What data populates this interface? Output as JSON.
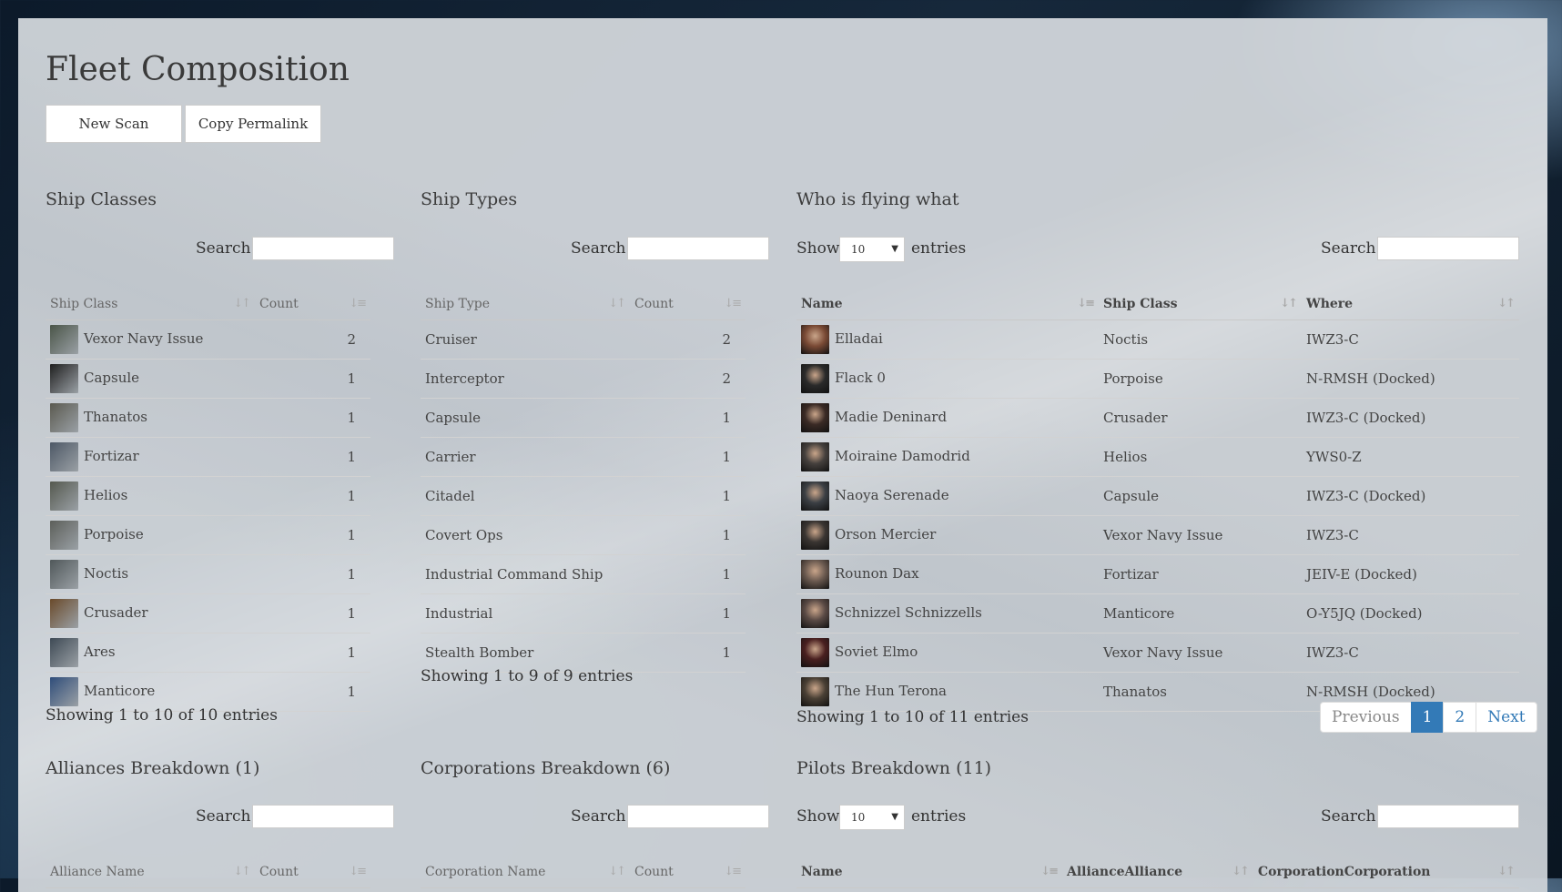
{
  "page_title": "Fleet Composition",
  "buttons": {
    "new_scan": "New Scan",
    "copy_permalink": "Copy Permalink"
  },
  "search_label": "Search:",
  "show_label": "Show",
  "entries_label": "entries",
  "ship_classes": {
    "title": "Ship Classes",
    "columns": [
      "Ship Class",
      "Count"
    ],
    "rows": [
      {
        "name": "Vexor Navy Issue",
        "count": "2",
        "color": "#4a5548"
      },
      {
        "name": "Capsule",
        "count": "1",
        "color": "#1f1f1f"
      },
      {
        "name": "Thanatos",
        "count": "1",
        "color": "#5b5a50"
      },
      {
        "name": "Fortizar",
        "count": "1",
        "color": "#4d5866"
      },
      {
        "name": "Helios",
        "count": "1",
        "color": "#55594f"
      },
      {
        "name": "Porpoise",
        "count": "1",
        "color": "#5c5f5a"
      },
      {
        "name": "Noctis",
        "count": "1",
        "color": "#50585a"
      },
      {
        "name": "Crusader",
        "count": "1",
        "color": "#6a4a2a"
      },
      {
        "name": "Ares",
        "count": "1",
        "color": "#3e4a55"
      },
      {
        "name": "Manticore",
        "count": "1",
        "color": "#2f4d7a"
      }
    ],
    "info": "Showing 1 to 10 of 10 entries"
  },
  "ship_types": {
    "title": "Ship Types",
    "columns": [
      "Ship Type",
      "Count"
    ],
    "rows": [
      {
        "name": "Cruiser",
        "count": "2"
      },
      {
        "name": "Interceptor",
        "count": "2"
      },
      {
        "name": "Capsule",
        "count": "1"
      },
      {
        "name": "Carrier",
        "count": "1"
      },
      {
        "name": "Citadel",
        "count": "1"
      },
      {
        "name": "Covert Ops",
        "count": "1"
      },
      {
        "name": "Industrial Command Ship",
        "count": "1"
      },
      {
        "name": "Industrial",
        "count": "1"
      },
      {
        "name": "Stealth Bomber",
        "count": "1"
      }
    ],
    "info": "Showing 1 to 9 of 9 entries"
  },
  "who_flying": {
    "title": "Who is flying what",
    "page_size": "10",
    "columns": [
      "Name",
      "Ship Class",
      "Where"
    ],
    "rows": [
      {
        "name": "Elladai",
        "ship": "Noctis",
        "where": "IWZ3-C",
        "color": "#7a4a35"
      },
      {
        "name": "Flack 0",
        "ship": "Porpoise",
        "where": "N-RMSH (Docked)",
        "color": "#2a2a2a"
      },
      {
        "name": "Madie Deninard",
        "ship": "Crusader",
        "where": "IWZ3-C (Docked)",
        "color": "#3a2a25"
      },
      {
        "name": "Moiraine Damodrid",
        "ship": "Helios",
        "where": "YWS0-Z",
        "color": "#45403d"
      },
      {
        "name": "Naoya Serenade",
        "ship": "Capsule",
        "where": "IWZ3-C (Docked)",
        "color": "#3b3f44"
      },
      {
        "name": "Orson Mercier",
        "ship": "Vexor Navy Issue",
        "where": "IWZ3-C",
        "color": "#3a3532"
      },
      {
        "name": "Rounon Dax",
        "ship": "Fortizar",
        "where": "JEIV-E (Docked)",
        "color": "#6b5a50"
      },
      {
        "name": "Schnizzel Schnizzells",
        "ship": "Manticore",
        "where": "O-Y5JQ (Docked)",
        "color": "#5a4a45"
      },
      {
        "name": "Soviet Elmo",
        "ship": "Vexor Navy Issue",
        "where": "IWZ3-C",
        "color": "#4a2020"
      },
      {
        "name": "The Hun Terona",
        "ship": "Thanatos",
        "where": "N-RMSH (Docked)",
        "color": "#4a4035"
      }
    ],
    "info": "Showing 1 to 10 of 11 entries",
    "pagination": {
      "previous": "Previous",
      "pages": [
        "1",
        "2"
      ],
      "next": "Next"
    }
  },
  "alliances": {
    "title": "Alliances Breakdown (1)",
    "columns": [
      "Alliance Name",
      "Count"
    ]
  },
  "corporations": {
    "title": "Corporations Breakdown (6)",
    "columns": [
      "Corporation Name",
      "Count"
    ]
  },
  "pilots": {
    "title": "Pilots Breakdown (11)",
    "page_size": "10",
    "columns": [
      "Name",
      "AllianceAlliance",
      "CorporationCorporation"
    ]
  }
}
